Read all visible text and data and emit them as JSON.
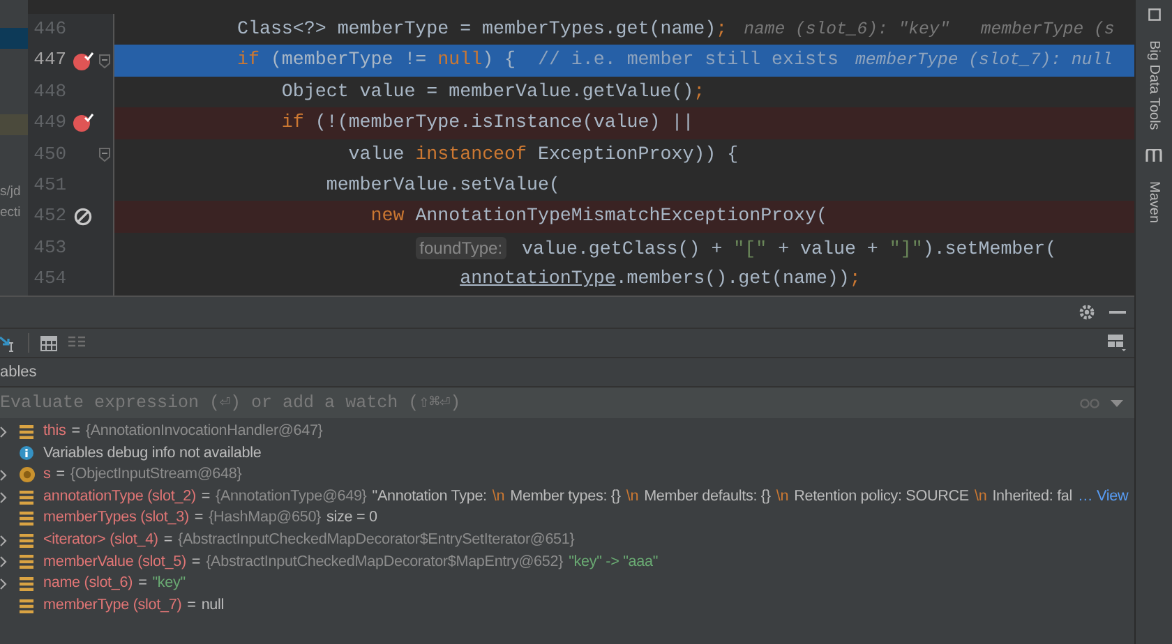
{
  "project_panel": {
    "labels": [
      "s/jd",
      "ecti"
    ]
  },
  "editor": {
    "lines": [
      {
        "number": "446",
        "current": false,
        "breakpoint": false,
        "muted": false,
        "fold": false,
        "tokens": [
          {
            "kind": "plain",
            "text": "Class<?> memberType = memberTypes.get(name)"
          },
          {
            "kind": "punct",
            "text": ";"
          },
          {
            "kind": "inlay",
            "text": "name (slot_6): \"key\"   memberType (s"
          }
        ]
      },
      {
        "number": "447",
        "current": true,
        "breakpoint": true,
        "muted": false,
        "fold": true,
        "tokens": [
          {
            "kind": "keyword",
            "text": "if"
          },
          {
            "kind": "plain",
            "text": " (memberType != "
          },
          {
            "kind": "keyword",
            "text": "null"
          },
          {
            "kind": "plain",
            "text": ") {  "
          },
          {
            "kind": "comment",
            "text": "// i.e. member still exists"
          },
          {
            "kind": "inlay",
            "text": "memberType (slot_7): null"
          }
        ]
      },
      {
        "number": "448",
        "current": false,
        "breakpoint": false,
        "muted": false,
        "fold": false,
        "tokens": [
          {
            "kind": "plain",
            "text": "    Object value = memberValue.getValue()"
          },
          {
            "kind": "punct",
            "text": ";"
          }
        ]
      },
      {
        "number": "449",
        "current": false,
        "breakpoint": true,
        "muted": false,
        "fold": false,
        "tokens": [
          {
            "kind": "keyword",
            "text": "    if"
          },
          {
            "kind": "plain",
            "text": " (!(memberType.isInstance(value) ||"
          }
        ]
      },
      {
        "number": "450",
        "current": false,
        "breakpoint": false,
        "muted": false,
        "fold": true,
        "tokens": [
          {
            "kind": "plain",
            "text": "          value "
          },
          {
            "kind": "keyword",
            "text": "instanceof"
          },
          {
            "kind": "plain",
            "text": " ExceptionProxy)) {"
          }
        ]
      },
      {
        "number": "451",
        "current": false,
        "breakpoint": false,
        "muted": false,
        "fold": false,
        "tokens": [
          {
            "kind": "plain",
            "text": "        memberValue.setValue("
          }
        ]
      },
      {
        "number": "452",
        "current": false,
        "breakpoint": true,
        "muted": true,
        "fold": false,
        "tokens": [
          {
            "kind": "keyword",
            "text": "            new"
          },
          {
            "kind": "plain",
            "text": " AnnotationTypeMismatchExceptionProxy("
          }
        ]
      },
      {
        "number": "453",
        "current": false,
        "breakpoint": false,
        "muted": false,
        "fold": false,
        "tokens": [
          {
            "kind": "hint",
            "text": "                foundType:"
          },
          {
            "kind": "plain",
            "text": " value.getClass() + "
          },
          {
            "kind": "string",
            "text": "\"[\""
          },
          {
            "kind": "plain",
            "text": " + value + "
          },
          {
            "kind": "string",
            "text": "\"]\""
          },
          {
            "kind": "plain",
            "text": ").setMember("
          }
        ]
      },
      {
        "number": "454",
        "current": false,
        "breakpoint": false,
        "muted": false,
        "fold": false,
        "tokens": [
          {
            "kind": "underline",
            "text": "                    annotationType"
          },
          {
            "kind": "plain",
            "text": ".members().get(name))"
          },
          {
            "kind": "punct",
            "text": ";"
          }
        ]
      }
    ]
  },
  "side_tools": [
    {
      "label": "Big Data Tools"
    },
    {
      "label": "Maven"
    }
  ],
  "debugger": {
    "tab": "ables",
    "watch_field": {
      "placeholder": "Evaluate expression (⏎) or add a watch (⇧⌘⏎)"
    },
    "variables": [
      {
        "expandable": true,
        "kind": "field",
        "name": "this",
        "value": [
          {
            "kind": "op",
            "text": "="
          },
          {
            "kind": "obj",
            "text": "{AnnotationInvocationHandler@647}"
          }
        ]
      },
      {
        "expandable": false,
        "kind": "info",
        "message": "Variables debug info not available"
      },
      {
        "expandable": true,
        "kind": "param",
        "name": "s",
        "value": [
          {
            "kind": "op",
            "text": "="
          },
          {
            "kind": "obj",
            "text": "{ObjectInputStream@648}"
          }
        ]
      },
      {
        "expandable": true,
        "kind": "field",
        "name": "annotationType (slot_2)",
        "value": [
          {
            "kind": "op",
            "text": "="
          },
          {
            "kind": "obj",
            "text": "{AnnotationType@649}"
          },
          {
            "kind": "text",
            "text": "\"Annotation Type:"
          },
          {
            "kind": "escape",
            "text": "\\n"
          },
          {
            "kind": "text",
            "text": "Member types: {}"
          },
          {
            "kind": "escape",
            "text": "\\n"
          },
          {
            "kind": "text",
            "text": "Member defaults: {}"
          },
          {
            "kind": "escape",
            "text": "\\n"
          },
          {
            "kind": "text",
            "text": "Retention policy: SOURCE"
          },
          {
            "kind": "escape",
            "text": "\\n"
          },
          {
            "kind": "text",
            "text": "Inherited: fal"
          },
          {
            "kind": "link",
            "text": "… View"
          }
        ]
      },
      {
        "expandable": false,
        "kind": "field",
        "name": "memberTypes (slot_3)",
        "value": [
          {
            "kind": "op",
            "text": "="
          },
          {
            "kind": "obj",
            "text": "{HashMap@650}"
          },
          {
            "kind": "text",
            "text": "size = 0"
          }
        ]
      },
      {
        "expandable": true,
        "kind": "field",
        "name": "<iterator> (slot_4)",
        "value": [
          {
            "kind": "op",
            "text": "="
          },
          {
            "kind": "obj",
            "text": "{AbstractInputCheckedMapDecorator$EntrySetIterator@651}"
          }
        ]
      },
      {
        "expandable": true,
        "kind": "field",
        "name": "memberValue (slot_5)",
        "value": [
          {
            "kind": "op",
            "text": "="
          },
          {
            "kind": "obj",
            "text": "{AbstractInputCheckedMapDecorator$MapEntry@652}"
          },
          {
            "kind": "string",
            "text": "\"key\" -> \"aaa\""
          }
        ]
      },
      {
        "expandable": true,
        "kind": "field",
        "name": "name (slot_6)",
        "value": [
          {
            "kind": "op",
            "text": "="
          },
          {
            "kind": "string",
            "text": "\"key\""
          }
        ]
      },
      {
        "expandable": false,
        "kind": "field",
        "name": "memberType (slot_7)",
        "value": [
          {
            "kind": "op",
            "text": "="
          },
          {
            "kind": "text",
            "text": "null"
          }
        ]
      }
    ]
  }
}
